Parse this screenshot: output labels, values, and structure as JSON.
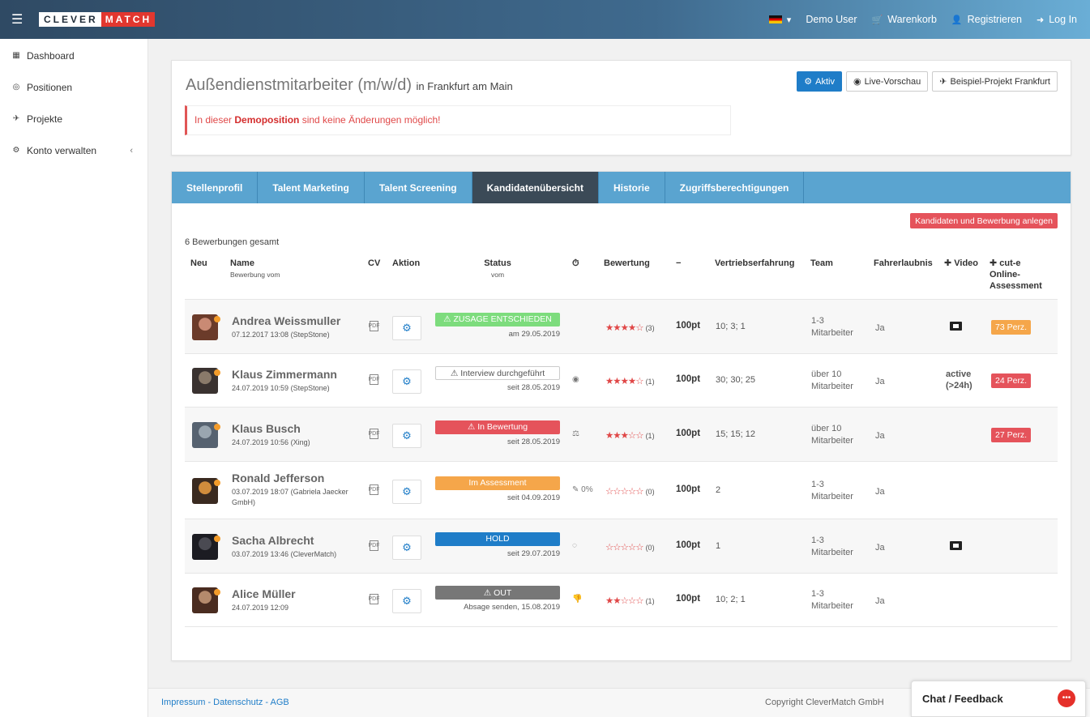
{
  "topbar": {
    "logo_left": "CLEVER",
    "logo_right": "MATCH",
    "user": "Demo User",
    "cart": "Warenkorb",
    "register": "Registrieren",
    "login": "Log In"
  },
  "sidebar": {
    "items": [
      {
        "label": "Dashboard",
        "icon": "grid-icon"
      },
      {
        "label": "Positionen",
        "icon": "target-icon"
      },
      {
        "label": "Projekte",
        "icon": "paper-plane-icon"
      },
      {
        "label": "Konto verwalten",
        "icon": "gears-icon"
      }
    ]
  },
  "header": {
    "title": "Außendienstmitarbeiter (m/w/d)",
    "location": "in Frankfurt am Main",
    "alert_prefix": "In dieser ",
    "alert_bold": "Demoposition",
    "alert_suffix": " sind keine Änderungen möglich!",
    "btn_active": "Aktiv",
    "btn_preview": "Live-Vorschau",
    "btn_project": "Beispiel-Projekt Frankfurt"
  },
  "tabs": [
    "Stellenprofil",
    "Talent Marketing",
    "Talent Screening",
    "Kandidatenübersicht",
    "Historie",
    "Zugriffsberechtigungen"
  ],
  "main": {
    "new_button": "Kandidaten und Bewerbung anlegen",
    "total": "6 Bewerbungen gesamt"
  },
  "columns": {
    "neu": "Neu",
    "name": "Name",
    "name_sub": "Bewerbung vom",
    "cv": "CV",
    "aktion": "Aktion",
    "status": "Status",
    "status_sub": "vom",
    "bewertung": "Bewertung",
    "minus": "−",
    "vertrieb": "Vertriebserfahrung",
    "team": "Team",
    "fahrer": "Fahrerlaubnis",
    "video": "✚ Video",
    "cut": "✚ cut-e Online-Assessment"
  },
  "candidates": [
    {
      "name": "Andrea Weissmuller",
      "date": "07.12.2017 13:08 (StepStone)",
      "status": "ZUSAGE ENTSCHIEDEN",
      "status_sub": "am 29.05.2019",
      "status_style": "green",
      "status_icon": "warning",
      "state_icon": "",
      "rating": 4,
      "rating_count": "(3)",
      "points": "100pt",
      "vertrieb": "10; 3; 1",
      "team": "1-3 Mitarbeiter",
      "fahrer": "Ja",
      "video": "film",
      "perz": "73 Perz.",
      "perz_color": "#f5a64a"
    },
    {
      "name": "Klaus Zimmermann",
      "date": "24.07.2019 10:59 (StepStone)",
      "status": "Interview durchgeführt",
      "status_sub": "seit 28.05.2019",
      "status_style": "outline",
      "status_icon": "warning",
      "state_icon": "◉",
      "rating": 4,
      "rating_count": "(1)",
      "points": "100pt",
      "vertrieb": "30; 30; 25",
      "team": "über 10 Mitarbeiter",
      "fahrer": "Ja",
      "video": "active (>24h)",
      "perz": "24 Perz.",
      "perz_color": "#e5535b"
    },
    {
      "name": "Klaus Busch",
      "date": "24.07.2019 10:56 (Xing)",
      "status": "In Bewertung",
      "status_sub": "seit 28.05.2019",
      "status_style": "red",
      "status_icon": "warning",
      "state_icon": "⚖",
      "rating": 3,
      "rating_count": "(1)",
      "points": "100pt",
      "vertrieb": "15; 15; 12",
      "team": "über 10 Mitarbeiter",
      "fahrer": "Ja",
      "video": "",
      "perz": "27 Perz.",
      "perz_color": "#e5535b"
    },
    {
      "name": "Ronald Jefferson",
      "date": "03.07.2019 18:07 (Gabriela Jaecker GmbH)",
      "status": "Im Assessment",
      "status_sub": "seit 04.09.2019",
      "status_style": "orange",
      "status_icon": "",
      "state_icon": "✎ 0%",
      "rating": 0,
      "rating_count": "(0)",
      "points": "100pt",
      "vertrieb": "2",
      "team": "1-3 Mitarbeiter",
      "fahrer": "Ja",
      "video": "",
      "perz": "",
      "perz_color": ""
    },
    {
      "name": "Sacha Albrecht",
      "date": "03.07.2019 13:46 (CleverMatch)",
      "status": "HOLD",
      "status_sub": "seit 29.07.2019",
      "status_style": "blue",
      "status_icon": "",
      "state_icon": "◌",
      "rating": 0,
      "rating_count": "(0)",
      "points": "100pt",
      "vertrieb": "1",
      "team": "1-3 Mitarbeiter",
      "fahrer": "Ja",
      "video": "film",
      "perz": "",
      "perz_color": ""
    },
    {
      "name": "Alice Müller",
      "date": "24.07.2019 12:09",
      "status": "OUT",
      "status_sub": "Absage senden, 15.08.2019",
      "status_style": "gray",
      "status_icon": "warning",
      "state_icon": "👎",
      "rating": 2,
      "rating_count": "(1)",
      "points": "100pt",
      "vertrieb": "10; 2; 1",
      "team": "1-3 Mitarbeiter",
      "fahrer": "Ja",
      "video": "",
      "perz": "",
      "perz_color": ""
    }
  ],
  "footer": {
    "links": "Impressum - Datenschutz - AGB",
    "copyright": "Copyright CleverMatch GmbH",
    "chat": "Chat / Feedback"
  },
  "colors": {
    "accent": "#1f7dc8",
    "danger": "#e5535b",
    "tab_bar": "#5aa4d0",
    "tab_active": "#3b4a57"
  }
}
